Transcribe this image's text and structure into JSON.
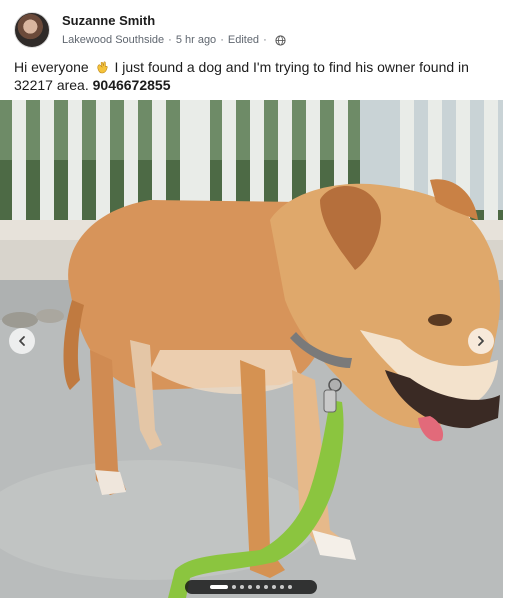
{
  "post": {
    "author": "Suzanne Smith",
    "location": "Lakewood Southside",
    "time": "5 hr ago",
    "edited": "Edited",
    "privacy_icon": "globe-icon",
    "text_before_emoji": "Hi everyone",
    "emoji_icon": "waving-hand-icon",
    "text_after_emoji": "I just found a dog and I'm trying to find his owner found in 32217 area.",
    "phone": "9046672855"
  },
  "gallery": {
    "prev_icon": "chevron-left-icon",
    "next_icon": "chevron-right-icon",
    "page_count": 9,
    "current_page": 1
  },
  "colors": {
    "dog_fur": "#d7945a",
    "leash": "#8bc53f",
    "porch_floor": "#b9bcbc"
  }
}
